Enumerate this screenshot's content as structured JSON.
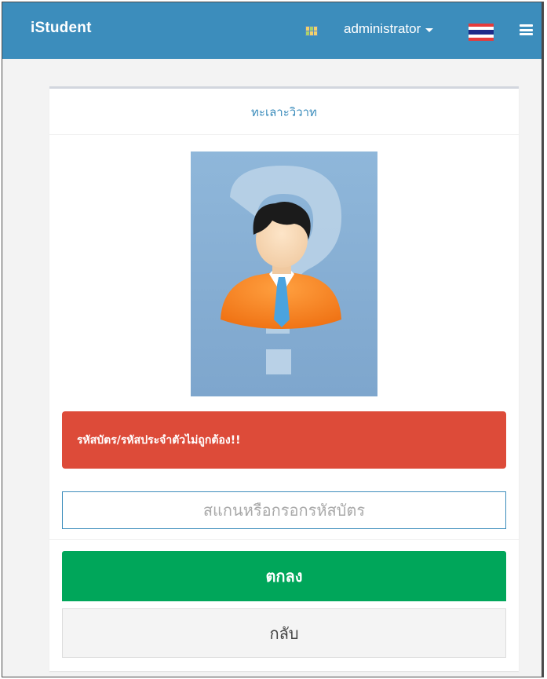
{
  "navbar": {
    "brand": "iStudent",
    "apps_icon": "grid-icon",
    "user_label": "administrator",
    "language_flag": "thailand-flag-icon",
    "menu_icon": "hamburger-icon",
    "background_color": "#3c8dbc"
  },
  "card": {
    "title": "ทะเลาะวิวาท",
    "photo_icon": "unknown-person-question-mark",
    "alert_text": "รหัสบัตร/รหัสประจำตัวไม่ถูกต้อง!!",
    "alert_color": "#dd4b39",
    "input": {
      "value": "",
      "placeholder": "สแกนหรือกรอกรหัสบัตร"
    },
    "ok_label": "ตกลง",
    "ok_color": "#00a65a",
    "back_label": "กลับ"
  }
}
